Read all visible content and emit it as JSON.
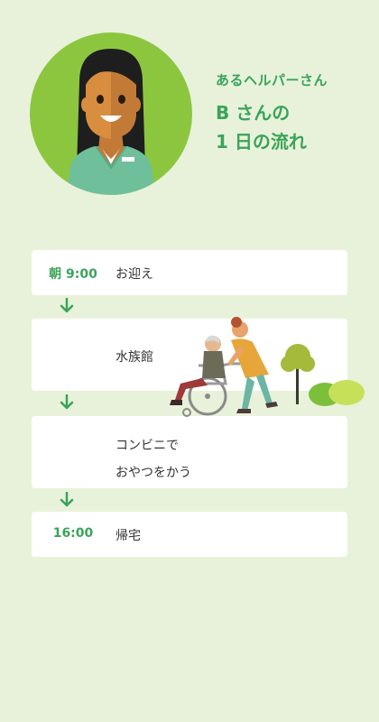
{
  "header": {
    "subtitle": "あるヘルパーさん",
    "title_line1": "B さんの",
    "title_line2": "1 日の流れ"
  },
  "schedule": [
    {
      "time": "朝 9:00",
      "task": "お迎え"
    },
    {
      "time": "",
      "task": "水族館"
    },
    {
      "time": "",
      "task_line1": "コンビニで",
      "task_line2": "おやつをかう"
    },
    {
      "time": "16:00",
      "task": "帰宅"
    }
  ],
  "colors": {
    "background": "#e8f2da",
    "accent_green": "#3aa45a",
    "card": "#ffffff",
    "avatar_circle": "#8cc63f"
  },
  "icons": [
    "helper-avatar-illustration",
    "down-arrow-icon",
    "wheelchair-helper-illustration",
    "tree-icon",
    "bush-icon"
  ]
}
